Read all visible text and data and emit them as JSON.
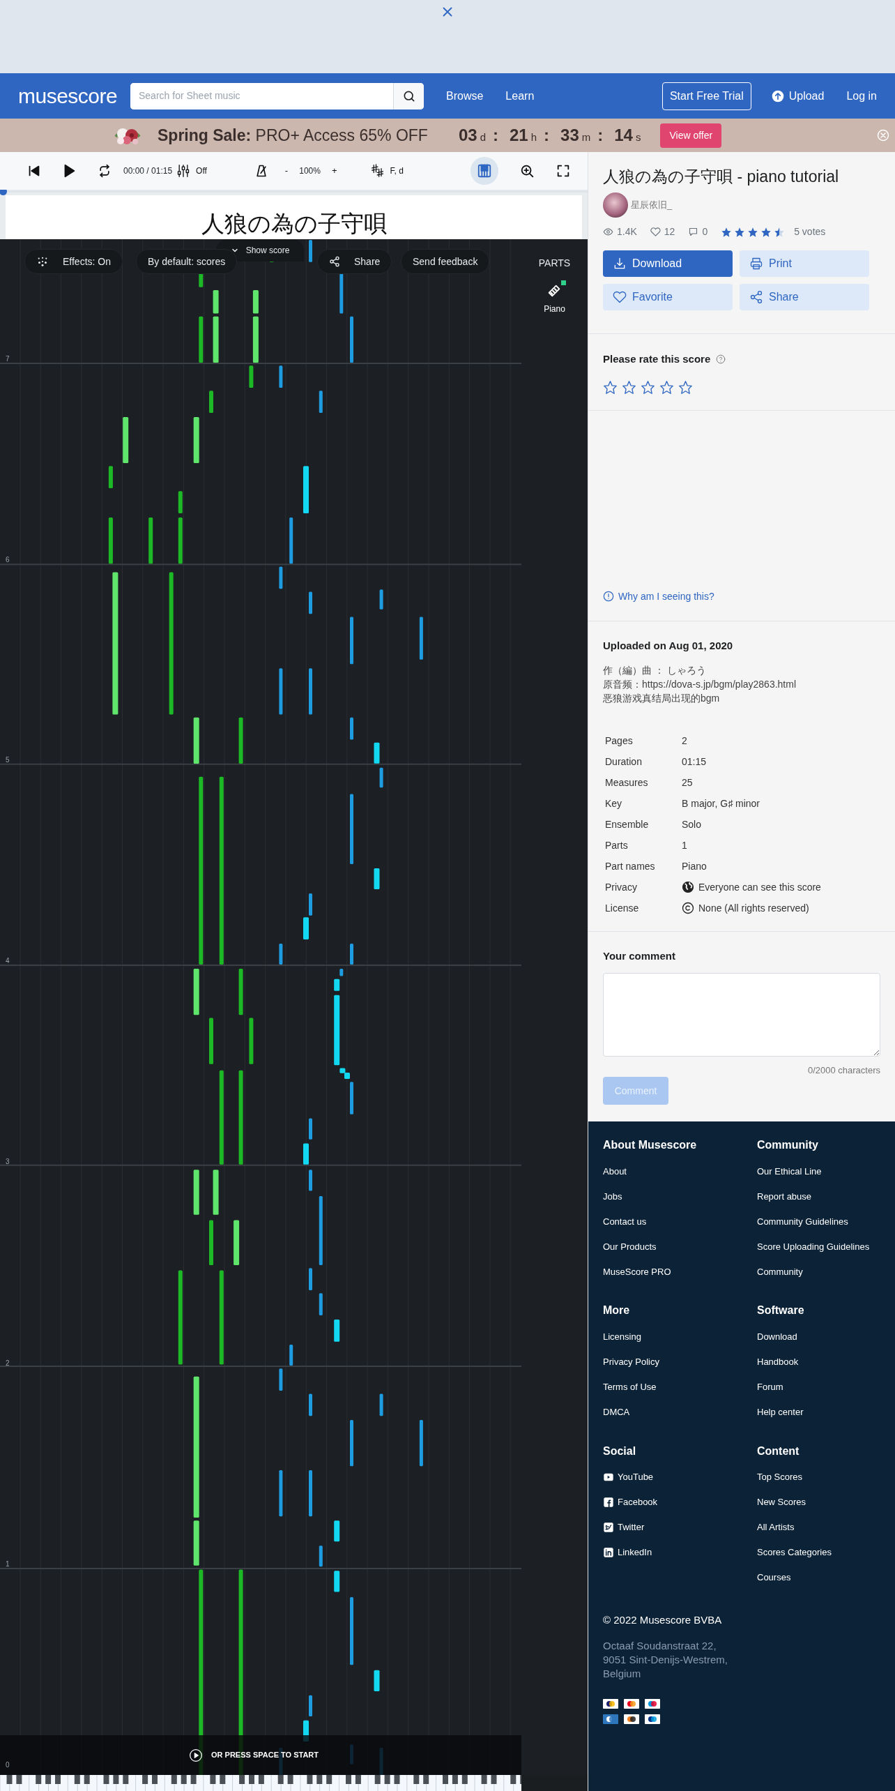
{
  "navbar": {
    "logo": "musescore",
    "search": {
      "placeholder": "Search for Sheet music"
    },
    "links": [
      "Browse",
      "Learn"
    ],
    "trial_button": "Start Free Trial",
    "upload": "Upload",
    "login": "Log in"
  },
  "sale_banner": {
    "title": "Spring Sale:",
    "offer": "PRO+ Access 65% OFF",
    "separator": ":",
    "countdown": [
      {
        "value": "03",
        "unit": "d"
      },
      {
        "value": "21",
        "unit": "h"
      },
      {
        "value": "33",
        "unit": "m"
      },
      {
        "value": "14",
        "unit": "s"
      }
    ],
    "button": "View offer"
  },
  "player": {
    "time": "00:00 / 01:15",
    "mixer": "Off",
    "zoom_minus": "-",
    "zoom": "100%",
    "zoom_plus": "+",
    "key": "F, d",
    "piano_roll_on": true,
    "progress": {
      "level": 0
    },
    "score_title": "人狼の為の子守唄",
    "show_score": "Show score",
    "chips": [
      {
        "label": "Effects: On",
        "kind": "effects"
      },
      {
        "label": "By default: scores",
        "kind": "plain"
      },
      {
        "label": "Share",
        "kind": "share"
      },
      {
        "label": "Send feedback",
        "kind": "plain"
      }
    ],
    "parts_heading": "PARTS",
    "parts": [
      {
        "name": "Piano",
        "selected": true
      }
    ],
    "measure_numbers": [
      "7",
      "6",
      "5",
      "4",
      "3",
      "2",
      "1",
      "0"
    ],
    "start_hint": "OR PRESS SPACE TO START"
  },
  "score": {
    "title": "人狼の為の子守唄 - piano tutorial",
    "author": "星辰依旧_",
    "views": "1.4K",
    "likes": "12",
    "comments": "0",
    "stars": 4.5,
    "votes": "5 votes",
    "buttons": [
      {
        "label": "Download",
        "kind": "download",
        "primary": true
      },
      {
        "label": "Print",
        "kind": "print",
        "primary": false
      },
      {
        "label": "Favorite",
        "kind": "favorite",
        "primary": false
      },
      {
        "label": "Share",
        "kind": "share",
        "primary": false
      }
    ]
  },
  "rating": {
    "heading": "Please rate this score",
    "stars": 0
  },
  "ad_notice": "Why am I seeing this?",
  "upload": {
    "heading": "Uploaded on Aug 01, 2020",
    "description": [
      {
        "text": "作（編）曲 ： しゃろう"
      },
      {
        "text": "原音频：",
        "link": "https://dova-s.jp/bgm/play2863.html"
      },
      {
        "text": "恶狼游戏真结局出现的bgm"
      }
    ],
    "details": [
      {
        "label": "Pages",
        "value": "2",
        "kind": "text"
      },
      {
        "label": "Duration",
        "value": "01:15",
        "kind": "text"
      },
      {
        "label": "Measures",
        "value": "25",
        "kind": "text"
      },
      {
        "label": "Key",
        "value": "B major, G♯  minor",
        "kind": "text"
      },
      {
        "label": "Ensemble",
        "value": "Solo",
        "kind": "link"
      },
      {
        "label": "Parts",
        "value": "1",
        "kind": "text"
      },
      {
        "label": "Part names",
        "value": "Piano",
        "kind": "link"
      },
      {
        "label": "Privacy",
        "value": "Everyone can see this score",
        "kind": "globe"
      },
      {
        "label": "License",
        "value": "None (All rights reserved)",
        "kind": "copyright"
      }
    ]
  },
  "comment": {
    "heading": "Your comment",
    "counter": "0/2000 characters",
    "button": "Comment",
    "button_disabled": true
  },
  "footer": {
    "columns": [
      {
        "heading": "About Musescore",
        "links": [
          {
            "label": "About"
          },
          {
            "label": "Jobs"
          },
          {
            "label": "Contact us"
          },
          {
            "label": "Our Products"
          },
          {
            "label": "MuseScore PRO"
          }
        ]
      },
      {
        "heading": "Community",
        "links": [
          {
            "label": "Our Ethical Line"
          },
          {
            "label": "Report abuse"
          },
          {
            "label": "Community Guidelines"
          },
          {
            "label": "Score Uploading Guidelines"
          },
          {
            "label": "Community"
          }
        ]
      },
      {
        "heading": "More",
        "links": [
          {
            "label": "Licensing"
          },
          {
            "label": "Privacy Policy"
          },
          {
            "label": "Terms of Use"
          },
          {
            "label": "DMCA"
          }
        ]
      },
      {
        "heading": "Software",
        "links": [
          {
            "label": "Download"
          },
          {
            "label": "Handbook"
          },
          {
            "label": "Forum"
          },
          {
            "label": "Help center"
          }
        ]
      },
      {
        "heading": "Social",
        "links": [
          {
            "label": "YouTube",
            "kind": "youtube"
          },
          {
            "label": "Facebook",
            "kind": "facebook"
          },
          {
            "label": "Twitter",
            "kind": "twitter"
          },
          {
            "label": "LinkedIn",
            "kind": "linkedin"
          }
        ]
      },
      {
        "heading": "Content",
        "links": [
          {
            "label": "Top Scores"
          },
          {
            "label": "New Scores"
          },
          {
            "label": "All Artists"
          },
          {
            "label": "Scores Categories"
          },
          {
            "label": "Courses"
          }
        ]
      }
    ],
    "copyright": "© 2022 Musescore BVBA",
    "address": "Octaaf Soudanstraat 22,\n9051 Sint-Denijs-Westrem,\nBelgium"
  }
}
